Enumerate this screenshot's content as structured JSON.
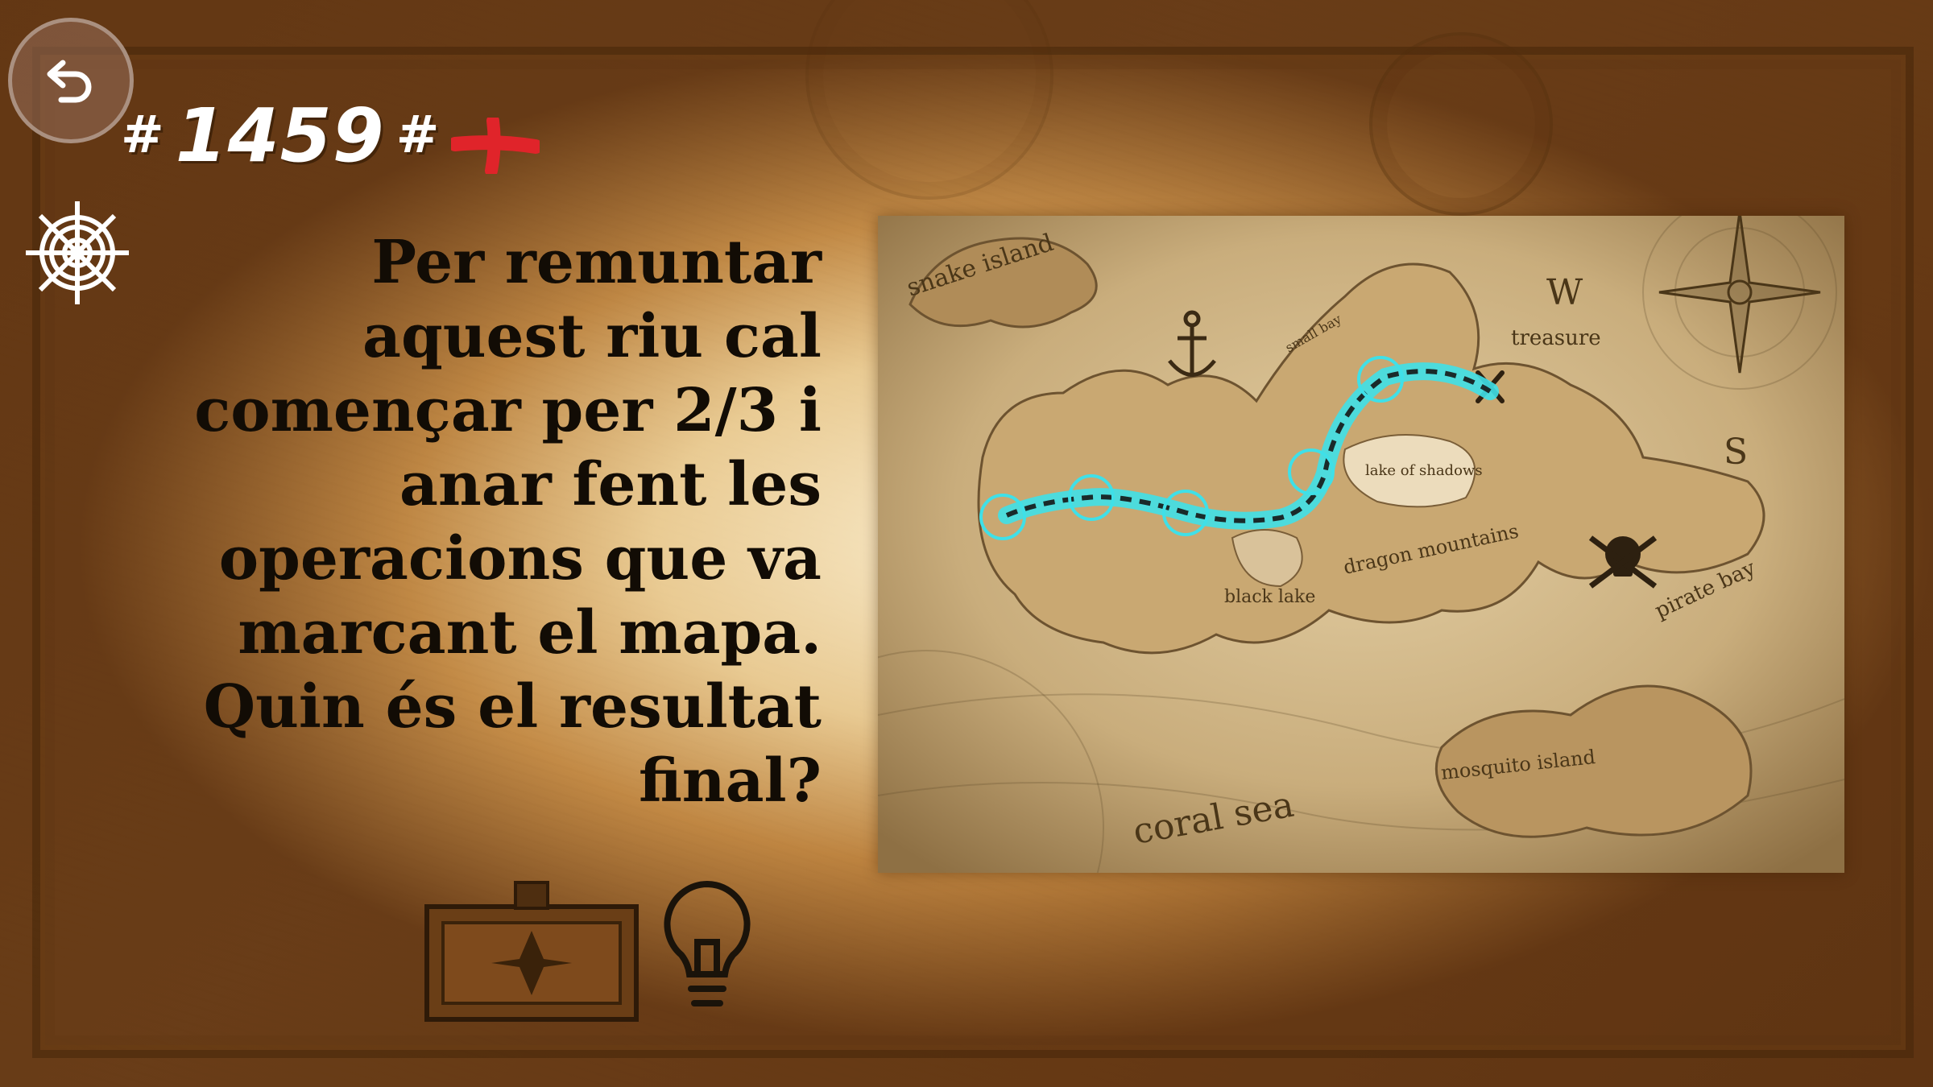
{
  "header": {
    "hash_left": "#",
    "puzzle_number": "1459",
    "hash_right": "#"
  },
  "question": {
    "text": "Per remuntar\naquest riu cal\ncomençar per 2/3 i\nanar fent les\noperacions que va\nmarcant el mapa.\nQuin és el resultat\nfinal?"
  },
  "map": {
    "labels": {
      "snake_island": "snake island",
      "small_bay": "small bay",
      "treasure": "treasure",
      "compass_w": "W",
      "compass_s": "S",
      "lake_of_shadows": "lake of shadows",
      "dragon_mountains": "dragon mountains",
      "black_lake": "black lake",
      "pirate_bay": "pirate bay",
      "mosquito_island": "mosquito island",
      "coral_sea": "coral sea"
    },
    "route_color": "#3fe0e8",
    "river_stops": 5
  },
  "icons": {
    "back": "back-arrow-icon",
    "settings": "ship-wheel-icon",
    "hint": "lightbulb-icon",
    "mark": "red-cross-icon",
    "chest": "treasure-chest-icon"
  },
  "colors": {
    "parchment": "#e9cf9c",
    "ink": "#120c05",
    "route": "#3fe0e8",
    "mark": "#e0242a"
  }
}
